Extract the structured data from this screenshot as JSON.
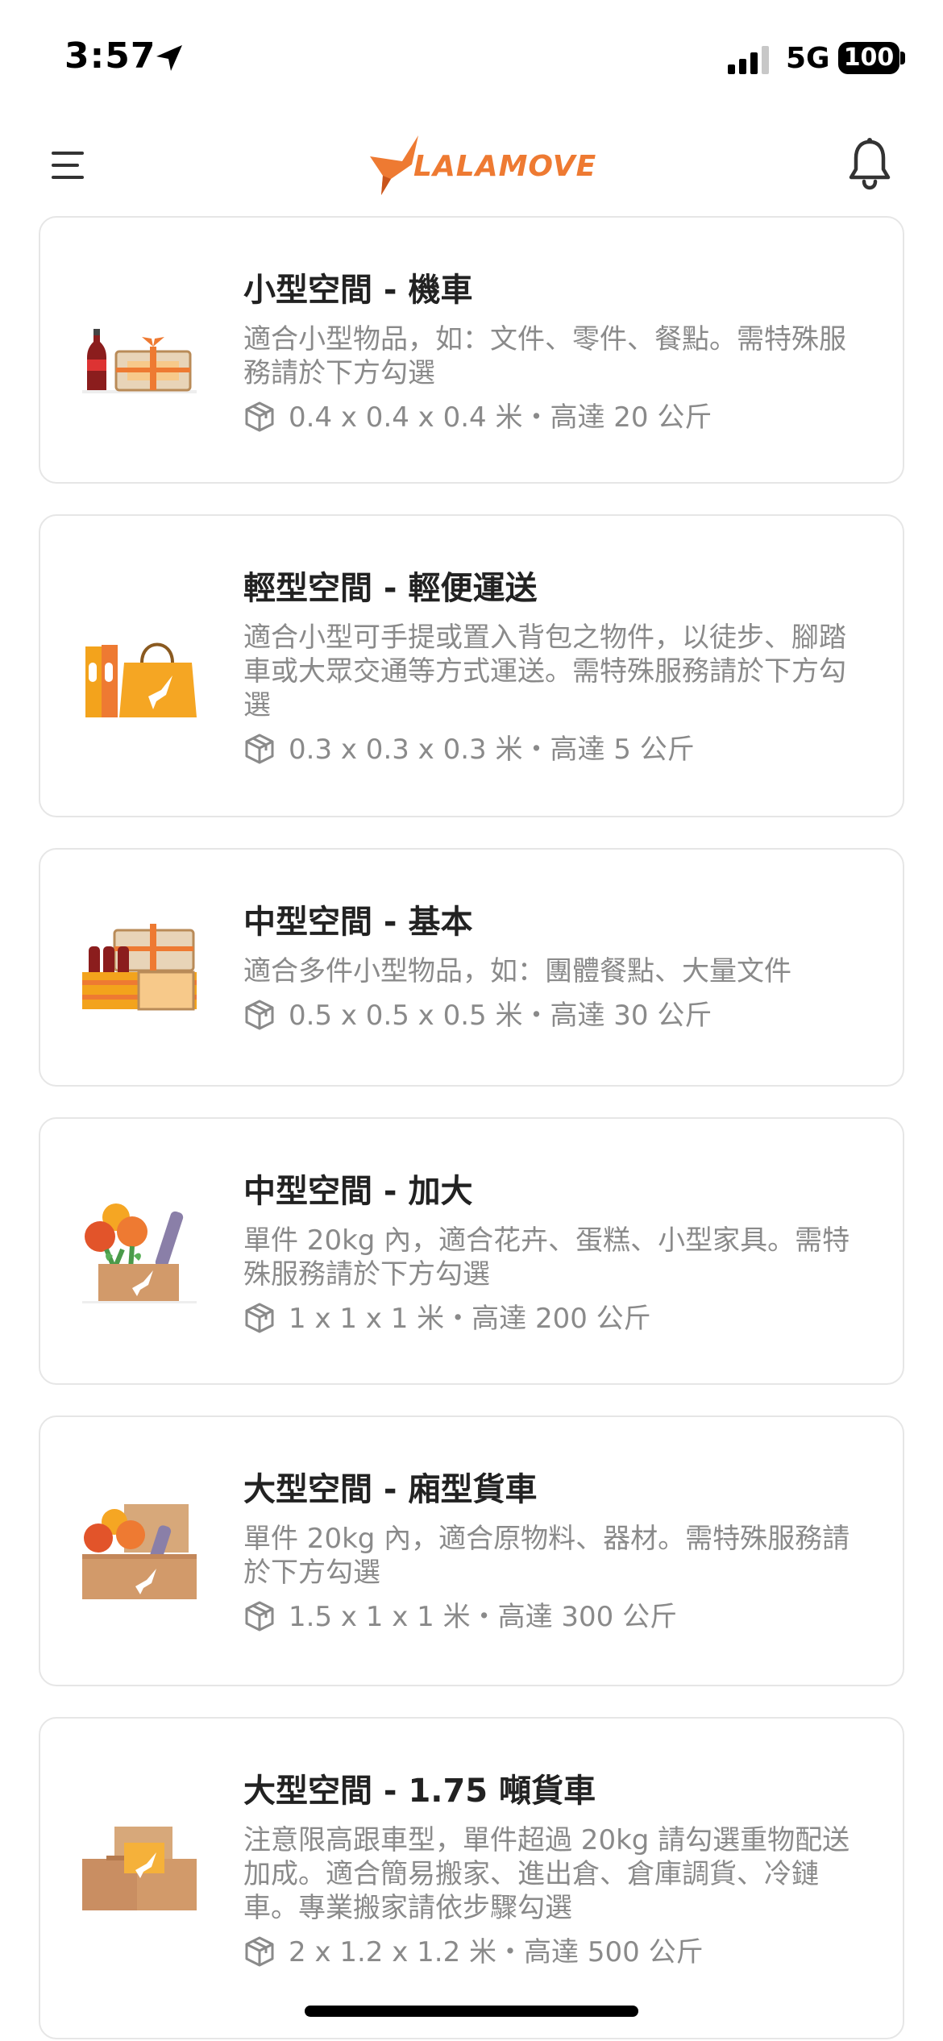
{
  "status_bar": {
    "time": "3:57",
    "network": "5G",
    "battery": "100"
  },
  "header": {
    "logo_text": "LALAMOVE",
    "brand_color": "#ee7a32"
  },
  "services": [
    {
      "title": "小型空間 - 機車",
      "description": "適合小型物品，如：文件、零件、餐點。需特殊服務請於下方勾選",
      "spec": "0.4 x 0.4 x 0.4 米・高達 20 公斤",
      "icon": "motorcycle-goods-icon"
    },
    {
      "title": "輕型空間 - 輕便運送",
      "description": "適合小型可手提或置入背包之物件，以徒步、腳踏車或大眾交通等方式運送。需特殊服務請於下方勾選",
      "spec": "0.3 x 0.3 x 0.3 米・高達 5 公斤",
      "icon": "light-delivery-icon"
    },
    {
      "title": "中型空間 - 基本",
      "description": "適合多件小型物品，如：團體餐點、大量文件",
      "spec": "0.5 x 0.5 x 0.5 米・高達 30 公斤",
      "icon": "medium-basic-icon"
    },
    {
      "title": "中型空間 - 加大",
      "description": "單件 20kg 內，適合花卉、蛋糕、小型家具。需特殊服務請於下方勾選",
      "spec": "1 x 1 x 1 米・高達 200 公斤",
      "icon": "medium-large-icon"
    },
    {
      "title": "大型空間 - 廂型貨車",
      "description": "單件 20kg 內，適合原物料、器材。需特殊服務請於下方勾選",
      "spec": "1.5 x 1 x 1 米・高達 300 公斤",
      "icon": "van-icon"
    },
    {
      "title": "大型空間 - 1.75 噸貨車",
      "description": "注意限高跟車型，單件超過 20kg 請勾選重物配送加成。適合簡易搬家、進出倉、倉庫調貨、冷鏈車。專業搬家請依步驟勾選",
      "spec": "2 x 1.2 x 1.2 米・高達 500 公斤",
      "icon": "truck-icon"
    }
  ]
}
